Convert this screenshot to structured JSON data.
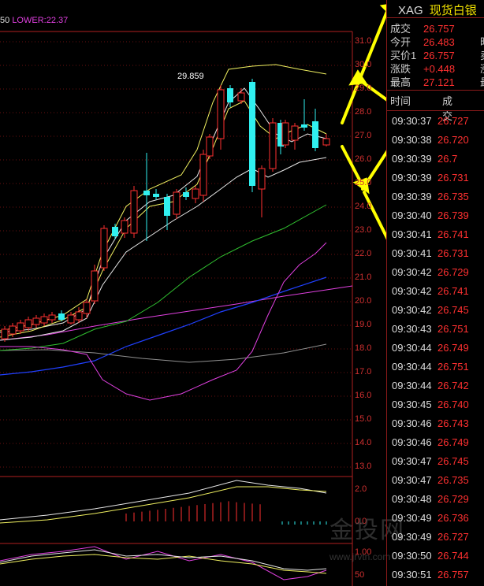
{
  "legend": {
    "left": "50",
    "lower": "LOWER:22.37"
  },
  "peak_label": "29.859",
  "price_axis": [
    "31.0",
    "30.0",
    "29.0",
    "28.0",
    "27.0",
    "26.0",
    "25.0",
    "24.0",
    "23.0",
    "22.0",
    "21.0",
    "20.0",
    "19.0",
    "18.0",
    "17.0",
    "16.0",
    "15.0",
    "14.0",
    "13.0"
  ],
  "sub_axis": [
    "2.0",
    "0.0",
    "1.00",
    "50"
  ],
  "header": {
    "symbol": "XAG",
    "name": "现货白银"
  },
  "quotes": [
    {
      "label": "成交",
      "value": "26.757",
      "cut": ""
    },
    {
      "label": "今开",
      "value": "26.483",
      "cut": "昨"
    },
    {
      "label": "买价1",
      "value": "26.757",
      "cut": "卖"
    },
    {
      "label": "涨跌",
      "value": "+0.448",
      "cut": "涨"
    },
    {
      "label": "最高",
      "value": "27.121",
      "cut": "最"
    }
  ],
  "ticks_header": {
    "time": "时间",
    "price": "成交"
  },
  "ticks": [
    {
      "time": "09:30:37",
      "price": "26.727"
    },
    {
      "time": "09:30:38",
      "price": "26.720"
    },
    {
      "time": "09:30:39",
      "price": "26.7"
    },
    {
      "time": "09:30:39",
      "price": "26.731"
    },
    {
      "time": "09:30:39",
      "price": "26.735"
    },
    {
      "time": "09:30:40",
      "price": "26.739"
    },
    {
      "time": "09:30:41",
      "price": "26.741"
    },
    {
      "time": "09:30:41",
      "price": "26.731"
    },
    {
      "time": "09:30:42",
      "price": "26.729"
    },
    {
      "time": "09:30:42",
      "price": "26.741"
    },
    {
      "time": "09:30:42",
      "price": "26.745"
    },
    {
      "time": "09:30:43",
      "price": "26.751"
    },
    {
      "time": "09:30:44",
      "price": "26.749"
    },
    {
      "time": "09:30:44",
      "price": "26.751"
    },
    {
      "time": "09:30:44",
      "price": "26.742"
    },
    {
      "time": "09:30:45",
      "price": "26.740"
    },
    {
      "time": "09:30:46",
      "price": "26.743"
    },
    {
      "time": "09:30:46",
      "price": "26.749"
    },
    {
      "time": "09:30:47",
      "price": "26.745"
    },
    {
      "time": "09:30:47",
      "price": "26.735"
    },
    {
      "time": "09:30:48",
      "price": "26.729"
    },
    {
      "time": "09:30:49",
      "price": "26.736"
    },
    {
      "time": "09:30:49",
      "price": "26.727"
    },
    {
      "time": "09:30:50",
      "price": "26.744"
    },
    {
      "time": "09:30:51",
      "price": "26.757"
    }
  ],
  "watermark": {
    "text": "金投网",
    "url": "www.jrvtn.com"
  },
  "colors": {
    "up": "#ff3030",
    "down": "#30f0f0",
    "ma_yellow": "#f0f060",
    "ma_green": "#30c030",
    "ma_blue": "#2040ff",
    "ma_magenta": "#e040e0",
    "ma_gray": "#909090"
  }
}
